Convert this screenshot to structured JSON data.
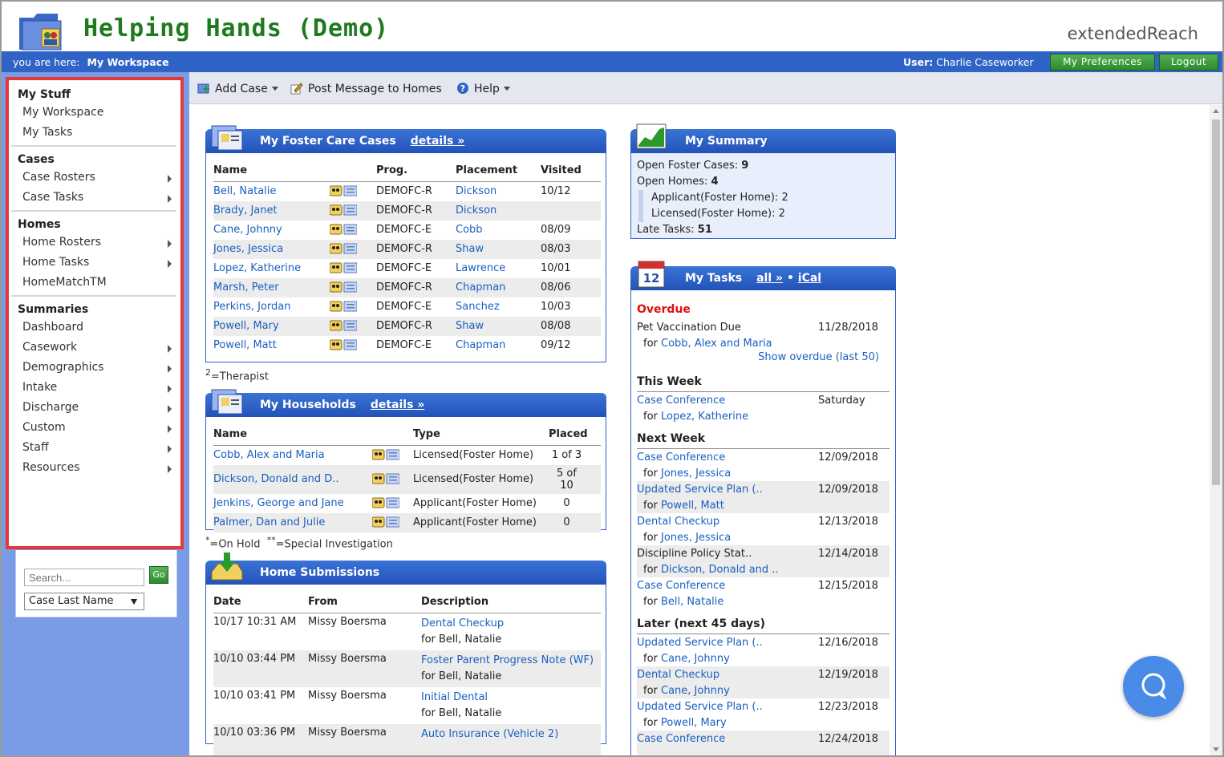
{
  "header": {
    "app_title": "Helping Hands (Demo)",
    "brand": "extendedReach",
    "you_are_here_label": "you are here:",
    "you_are_here_value": "My Workspace",
    "user_label": "User:",
    "user_name": "Charlie Caseworker",
    "preferences_label": "My Preferences",
    "logout_label": "Logout"
  },
  "sidebar": {
    "sections": [
      {
        "title": "My Stuff",
        "items": [
          {
            "label": "My Workspace",
            "arrow": false
          },
          {
            "label": "My Tasks",
            "arrow": false
          }
        ]
      },
      {
        "title": "Cases",
        "items": [
          {
            "label": "Case Rosters",
            "arrow": true
          },
          {
            "label": "Case Tasks",
            "arrow": true
          }
        ]
      },
      {
        "title": "Homes",
        "items": [
          {
            "label": "Home Rosters",
            "arrow": true
          },
          {
            "label": "Home Tasks",
            "arrow": true
          },
          {
            "label": "HomeMatchTM",
            "arrow": false
          }
        ]
      },
      {
        "title": "Summaries",
        "items": [
          {
            "label": "Dashboard",
            "arrow": false
          },
          {
            "label": "Casework",
            "arrow": true
          },
          {
            "label": "Demographics",
            "arrow": true
          },
          {
            "label": "Intake",
            "arrow": true
          },
          {
            "label": "Discharge",
            "arrow": true
          },
          {
            "label": "Custom",
            "arrow": true
          },
          {
            "label": "Staff",
            "arrow": true
          },
          {
            "label": "Resources",
            "arrow": true
          }
        ]
      }
    ],
    "search_placeholder": "Search...",
    "go_label": "Go",
    "search_type": "Case Last Name"
  },
  "toolbar": {
    "add_case": "Add Case",
    "post_message": "Post Message to Homes",
    "help": "Help"
  },
  "cases_panel": {
    "title": "My Foster Care Cases",
    "details_link": "details »",
    "columns": [
      "Name",
      "Prog.",
      "Placement",
      "Visited"
    ],
    "rows": [
      {
        "name": "Bell, Natalie",
        "prog": "DEMOFC-R",
        "placement": "Dickson",
        "visited": "10/12"
      },
      {
        "name": "Brady, Janet",
        "prog": "DEMOFC-R",
        "placement": "Dickson",
        "visited": ""
      },
      {
        "name": "Cane, Johnny",
        "prog": "DEMOFC-E",
        "placement": "Cobb",
        "visited": "08/09"
      },
      {
        "name": "Jones, Jessica",
        "prog": "DEMOFC-R",
        "placement": "Shaw",
        "visited": "08/03"
      },
      {
        "name": "Lopez, Katherine",
        "prog": "DEMOFC-E",
        "placement": "Lawrence",
        "visited": "10/01"
      },
      {
        "name": "Marsh, Peter",
        "prog": "DEMOFC-R",
        "placement": "Chapman",
        "visited": "08/06"
      },
      {
        "name": "Perkins, Jordan",
        "prog": "DEMOFC-E",
        "placement": "Sanchez",
        "visited": "10/03"
      },
      {
        "name": "Powell, Mary",
        "prog": "DEMOFC-R",
        "placement": "Shaw",
        "visited": "08/08"
      },
      {
        "name": "Powell, Matt",
        "prog": "DEMOFC-E",
        "placement": "Chapman",
        "visited": "09/12"
      }
    ],
    "footnote_sup": "2",
    "footnote_text": "=Therapist"
  },
  "households_panel": {
    "title": "My Households",
    "details_link": "details »",
    "columns": [
      "Name",
      "Type",
      "Placed"
    ],
    "rows": [
      {
        "name": "Cobb, Alex and Maria",
        "type": "Licensed(Foster Home)",
        "placed": "1 of 3"
      },
      {
        "name": "Dickson, Donald and D..",
        "type": "Licensed(Foster Home)",
        "placed": "5 of 10"
      },
      {
        "name": "Jenkins, George and Jane",
        "type": "Applicant(Foster Home)",
        "placed": "0"
      },
      {
        "name": "Palmer, Dan and Julie",
        "type": "Applicant(Foster Home)",
        "placed": "0"
      }
    ],
    "footnote1_sup": "*",
    "footnote1_text": "=On Hold",
    "footnote2_sup": "**",
    "footnote2_text": "=Special Investigation"
  },
  "submissions_panel": {
    "title": "Home Submissions",
    "columns": [
      "Date",
      "From",
      "Description"
    ],
    "rows": [
      {
        "date": "10/17 10:31 AM",
        "from": "Missy Boersma",
        "description": "Dental Checkup",
        "for": "for Bell, Natalie"
      },
      {
        "date": "10/10 03:44 PM",
        "from": "Missy Boersma",
        "description": "Foster Parent Progress Note (WF)",
        "for": "for Bell, Natalie"
      },
      {
        "date": "10/10 03:41 PM",
        "from": "Missy Boersma",
        "description": "Initial Dental",
        "for": "for Bell, Natalie"
      },
      {
        "date": "10/10 03:36 PM",
        "from": "Missy Boersma",
        "description": "Auto Insurance (Vehicle 2)",
        "for": ""
      }
    ]
  },
  "summary_panel": {
    "title": "My Summary",
    "open_cases_label": "Open Foster Cases:",
    "open_cases": "9",
    "open_homes_label": "Open Homes:",
    "open_homes": "4",
    "applicant_label": "Applicant(Foster Home):",
    "applicant": "2",
    "licensed_label": "Licensed(Foster Home):",
    "licensed": "2",
    "late_tasks_label": "Late Tasks:",
    "late_tasks": "51"
  },
  "tasks_panel": {
    "title": "My Tasks",
    "all_link": "all »",
    "separator": "•",
    "ical_link": "iCal",
    "overdue_label": "Overdue",
    "overdue": [
      {
        "task": "Pet Vaccination Due",
        "task_link": false,
        "date": "11/28/2018",
        "for_prefix": "for",
        "for_name": "Cobb, Alex and Maria"
      }
    ],
    "show_overdue": "Show overdue (last 50)",
    "this_week_label": "This Week",
    "this_week": [
      {
        "task": "Case Conference",
        "task_link": true,
        "date": "Saturday",
        "for_prefix": "for",
        "for_name": "Lopez, Katherine"
      }
    ],
    "next_week_label": "Next Week",
    "next_week": [
      {
        "task": "Case Conference",
        "task_link": true,
        "date": "12/09/2018",
        "for_prefix": "for",
        "for_name": "Jones, Jessica"
      },
      {
        "task": "Updated Service Plan (..",
        "task_link": true,
        "date": "12/09/2018",
        "for_prefix": "for",
        "for_name": "Powell, Matt"
      },
      {
        "task": "Dental Checkup",
        "task_link": true,
        "date": "12/13/2018",
        "for_prefix": "for",
        "for_name": "Jones, Jessica"
      },
      {
        "task": "Discipline Policy Stat..",
        "task_link": false,
        "date": "12/14/2018",
        "for_prefix": "for",
        "for_name": "Dickson, Donald and .."
      },
      {
        "task": "Case Conference",
        "task_link": true,
        "date": "12/15/2018",
        "for_prefix": "for",
        "for_name": "Bell, Natalie"
      }
    ],
    "later_label": "Later (next 45 days)",
    "later": [
      {
        "task": "Updated Service Plan (..",
        "task_link": true,
        "date": "12/16/2018",
        "for_prefix": "for",
        "for_name": "Cane, Johnny"
      },
      {
        "task": "Dental Checkup",
        "task_link": true,
        "date": "12/19/2018",
        "for_prefix": "for",
        "for_name": "Cane, Johnny"
      },
      {
        "task": "Updated Service Plan (..",
        "task_link": true,
        "date": "12/23/2018",
        "for_prefix": "for",
        "for_name": "Powell, Mary"
      },
      {
        "task": "Case Conference",
        "task_link": true,
        "date": "12/24/2018",
        "for_prefix": "",
        "for_name": ""
      }
    ]
  },
  "colors": {
    "brand_blue": "#2f63c6",
    "title_green": "#1d7a1d",
    "link_blue": "#1a5fbf",
    "overdue_red": "#e01010",
    "highlight_red": "#e53838"
  }
}
